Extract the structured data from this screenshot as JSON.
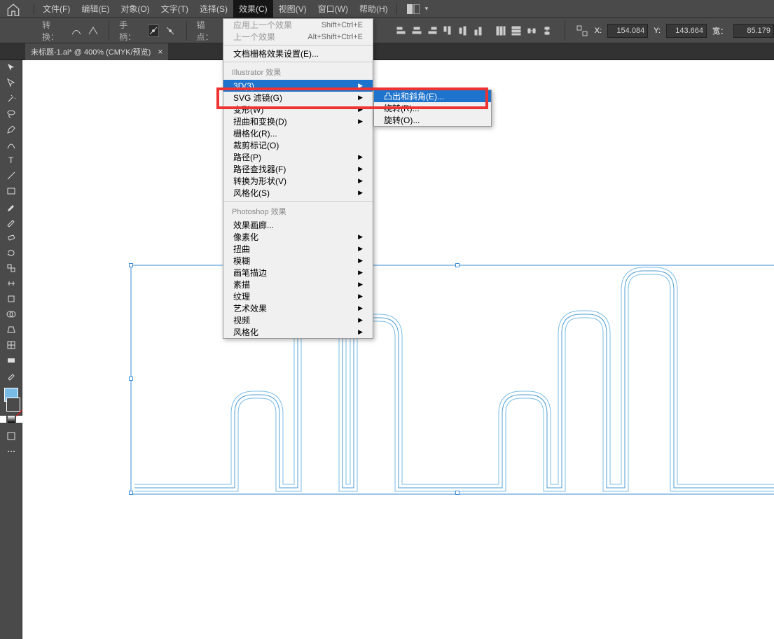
{
  "menubar": {
    "items": [
      "文件(F)",
      "编辑(E)",
      "对象(O)",
      "文字(T)",
      "选择(S)",
      "效果(C)",
      "视图(V)",
      "窗口(W)",
      "帮助(H)"
    ],
    "active_index": 5
  },
  "optionsbar": {
    "convert_label": "转换：",
    "hand_label": "手柄：",
    "anchor_label": "锚点：",
    "coords": {
      "x_label": "X:",
      "x_value": "154.084",
      "y_label": "Y:",
      "y_value": "143.664",
      "w_label": "宽：",
      "w_value": "85.179"
    }
  },
  "tab": {
    "title": "未标题-1.ai* @ 400% (CMYK/预览)"
  },
  "menu_main": {
    "sec_a": [
      {
        "label": "应用上一个效果",
        "shortcut": "Shift+Ctrl+E",
        "disabled": true
      },
      {
        "label": "上一个效果",
        "shortcut": "Alt+Shift+Ctrl+E",
        "disabled": true
      }
    ],
    "sec_b": [
      {
        "label": "文档栅格效果设置(E)..."
      }
    ],
    "header_illustrator": "Illustrator 效果",
    "sec_c": [
      {
        "label": "3D(3)",
        "arrow": true,
        "highlight": true
      },
      {
        "label": "SVG 滤镜(G)",
        "arrow": true
      },
      {
        "label": "变形(W)",
        "arrow": true
      },
      {
        "label": "扭曲和变换(D)",
        "arrow": true
      },
      {
        "label": "栅格化(R)..."
      },
      {
        "label": "裁剪标记(O)"
      },
      {
        "label": "路径(P)",
        "arrow": true
      },
      {
        "label": "路径查找器(F)",
        "arrow": true
      },
      {
        "label": "转换为形状(V)",
        "arrow": true
      },
      {
        "label": "风格化(S)",
        "arrow": true
      }
    ],
    "header_photoshop": "Photoshop 效果",
    "sec_d": [
      {
        "label": "效果画廊..."
      },
      {
        "label": "像素化",
        "arrow": true
      },
      {
        "label": "扭曲",
        "arrow": true
      },
      {
        "label": "模糊",
        "arrow": true
      },
      {
        "label": "画笔描边",
        "arrow": true
      },
      {
        "label": "素描",
        "arrow": true
      },
      {
        "label": "纹理",
        "arrow": true
      },
      {
        "label": "艺术效果",
        "arrow": true
      },
      {
        "label": "视频",
        "arrow": true
      },
      {
        "label": "风格化",
        "arrow": true
      }
    ]
  },
  "menu_sub": {
    "items": [
      {
        "label": "凸出和斜角(E)...",
        "highlight": true
      },
      {
        "label": "绕转(R)..."
      },
      {
        "label": "旋转(O)..."
      }
    ]
  },
  "toolbox": {
    "tools": [
      "selection",
      "direct-selection",
      "magic-wand",
      "lasso",
      "pen",
      "curvature",
      "type",
      "line",
      "rectangle",
      "paintbrush",
      "pencil",
      "eraser",
      "rotate",
      "scale",
      "width",
      "free-transform",
      "shape-builder",
      "perspective",
      "mesh",
      "gradient",
      "eyedropper",
      "blend",
      "symbol-sprayer",
      "column-graph",
      "artboard",
      "slice",
      "hand",
      "zoom"
    ]
  }
}
